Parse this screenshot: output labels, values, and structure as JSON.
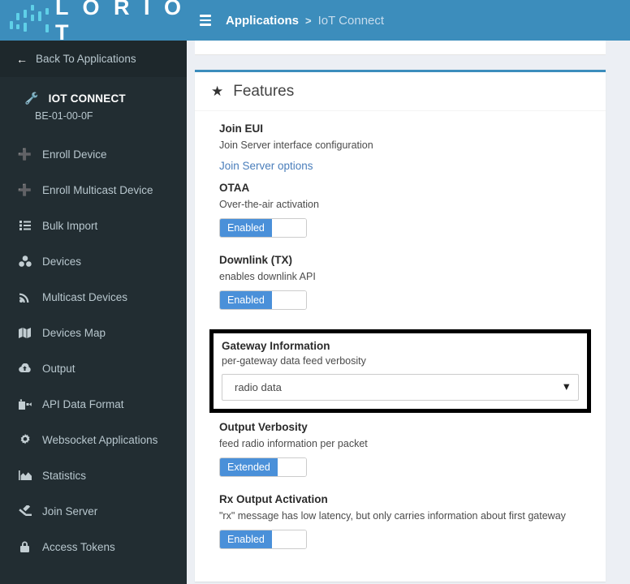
{
  "brand": {
    "name": "L O R I O T",
    "logo_icon": "loriot-dots-logo",
    "header_color": "#3c8dbc",
    "sidebar_color": "#222d32"
  },
  "sidebar": {
    "back": {
      "label": "Back To Applications",
      "icon": "arrow-left-icon"
    },
    "application": {
      "icon": "wrench-icon",
      "name": "IOT CONNECT",
      "id": "BE-01-00-0F"
    },
    "items": [
      {
        "label": "Enroll Device",
        "icon": "plus-icon"
      },
      {
        "label": "Enroll Multicast Device",
        "icon": "plus-icon"
      },
      {
        "label": "Bulk Import",
        "icon": "list-icon"
      },
      {
        "label": "Devices",
        "icon": "devices-icon"
      },
      {
        "label": "Multicast Devices",
        "icon": "broadcast-icon"
      },
      {
        "label": "Devices Map",
        "icon": "map-icon"
      },
      {
        "label": "Output",
        "icon": "cloud-upload-icon"
      },
      {
        "label": "API Data Format",
        "icon": "api-format-icon"
      },
      {
        "label": "Websocket Applications",
        "icon": "gear-icon"
      },
      {
        "label": "Statistics",
        "icon": "chart-area-icon"
      },
      {
        "label": "Join Server",
        "icon": "gavel-icon"
      },
      {
        "label": "Access Tokens",
        "icon": "lock-icon"
      }
    ]
  },
  "topbar": {
    "menu_icon": "hamburger-icon",
    "breadcrumb": {
      "root": "Applications",
      "separator": ">",
      "leaf": "IoT Connect"
    }
  },
  "panel": {
    "icon": "star-icon",
    "title": "Features",
    "accent_color": "#3c8dbc",
    "features": [
      {
        "name": "join-eui",
        "title": "Join EUI",
        "description": "Join Server interface configuration",
        "control": "link",
        "link_label": "Join Server options"
      },
      {
        "name": "otaa",
        "title": "OTAA",
        "description": "Over-the-air activation",
        "control": "toggle",
        "toggle_label": "Enabled"
      },
      {
        "name": "downlink-tx",
        "title": "Downlink (TX)",
        "description": "enables downlink API",
        "control": "toggle",
        "toggle_label": "Enabled"
      },
      {
        "name": "gateway-information",
        "title": "Gateway Information",
        "description": "per-gateway data feed verbosity",
        "control": "select",
        "selected": "radio data",
        "options": [
          "radio data"
        ],
        "highlighted": true,
        "highlight_color": "#000000"
      },
      {
        "name": "output-verbosity",
        "title": "Output Verbosity",
        "description": "feed radio information per packet",
        "control": "toggle",
        "toggle_label": "Extended"
      },
      {
        "name": "rx-output-activation",
        "title": "Rx Output Activation",
        "description": "\"rx\" message has low latency, but only carries information about first gateway",
        "control": "toggle",
        "toggle_label": "Enabled"
      }
    ]
  }
}
